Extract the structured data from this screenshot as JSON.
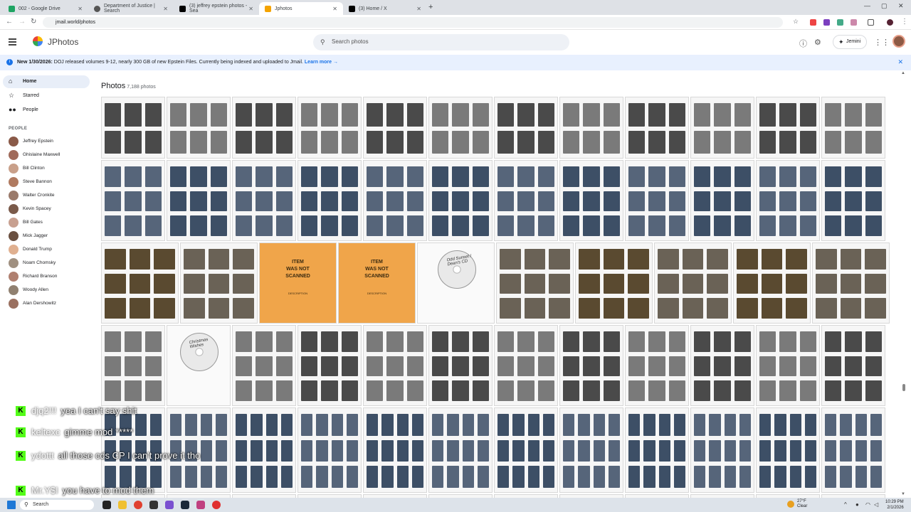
{
  "browser": {
    "tabs": [
      {
        "title": "002 - Google Drive",
        "color": "#1fa463"
      },
      {
        "title": "Department of Justice | Search",
        "color": "#555555"
      },
      {
        "title": "(3) jeffrey epstein photos - Sea",
        "color": "#000000"
      },
      {
        "title": "Jphotos",
        "color": "#f4a300"
      },
      {
        "title": "(3) Home / X",
        "color": "#000000"
      }
    ],
    "new_tab": "+",
    "url": "jmail.world/photos"
  },
  "app": {
    "name": "JPhotos",
    "search_placeholder": "Search photos",
    "jemini_label": "Jemini"
  },
  "banner": {
    "prefix": "New 1/30/2026:",
    "text": " DOJ released volumes 9-12, nearly 300 GB of new Epstein Files. Currently being indexed and uploaded to Jmail.",
    "link": "Learn more →"
  },
  "sidebar": {
    "nav": [
      {
        "label": "Home",
        "icon": "home-icon",
        "glyph": "⌂"
      },
      {
        "label": "Starred",
        "icon": "star-icon",
        "glyph": "☆"
      },
      {
        "label": "People",
        "icon": "people-icon",
        "glyph": "👥"
      }
    ],
    "people_heading": "PEOPLE",
    "people": [
      "Jeffrey Epstein",
      "Ghislaine Maxwell",
      "Bill Clinton",
      "Steve Bannon",
      "Walter Cronkite",
      "Kevin Spacey",
      "Bill Gates",
      "Mick Jagger",
      "Donald Trump",
      "Noam Chomsky",
      "Richard Branson",
      "Woody Allen",
      "Alan Dershowitz"
    ],
    "avatar_colors": [
      "#8a5a48",
      "#a06a5a",
      "#c9a08a",
      "#b07a60",
      "#9a7a6a",
      "#7a5a4a",
      "#c8a090",
      "#6a5040",
      "#e0b090",
      "#a09080",
      "#b08070",
      "#908070",
      "#9a7060"
    ]
  },
  "main": {
    "title": "Photos",
    "count": "7,188 photos",
    "item_not_scanned": [
      "ITEM",
      "WAS NOT",
      "SCANNED"
    ],
    "description_label": "DESCRIPTION",
    "cd_label_1": "Odd Sunset / Dean's CD",
    "cd_label_2": "Christmas Wishes"
  },
  "chat": [
    {
      "user": "djq2!!!",
      "text": "yea I can't say shit"
    },
    {
      "user": "keltexc",
      "text": "gimme mod *****"
    },
    {
      "user": "ydottt",
      "text": "all those cds CP I can't prove it tho"
    },
    {
      "user": "Mr.Y$I",
      "text": "you have to mod them"
    }
  ],
  "taskbar": {
    "search_label": "Search",
    "weather_temp": "27°F",
    "weather_desc": "Clear",
    "time": "10:29 PM",
    "date": "2/1/2026"
  }
}
